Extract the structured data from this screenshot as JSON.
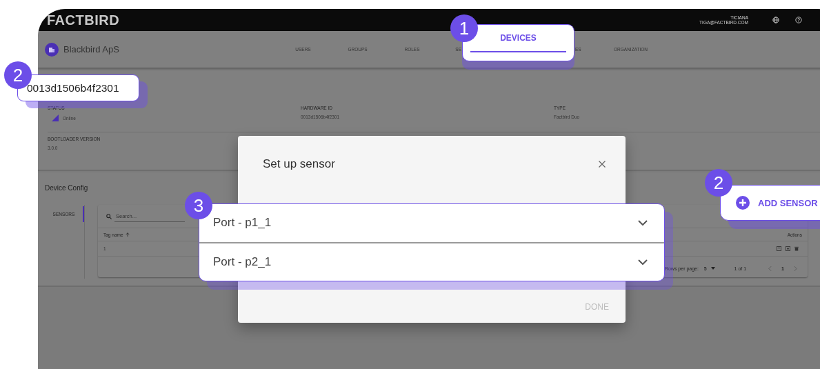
{
  "header": {
    "logo": "FACTBIRD",
    "user_name": "TICIANA",
    "user_email": "TIGA@FACTBIRD.COM"
  },
  "org_bar": {
    "name": "Blackbird ApS",
    "tabs": [
      {
        "label": "USERS",
        "selected": false
      },
      {
        "label": "GROUPS",
        "selected": false
      },
      {
        "label": "ROLES",
        "selected": false
      },
      {
        "label": "SE",
        "selected": false
      },
      {
        "label": "DEVICES",
        "selected": true,
        "step": "1"
      },
      {
        "label": "ES",
        "selected": false
      },
      {
        "label": "ORGANIZATION",
        "selected": false
      }
    ]
  },
  "hardware_id_callout": {
    "step": "2",
    "text": "0013d1506b4f2301"
  },
  "device_info": {
    "fields": [
      {
        "label": "STATUS",
        "value": "Online",
        "kind": "status"
      },
      {
        "label": "HARDWARE ID",
        "value": "0013d1506b4f2301",
        "kind": "text"
      },
      {
        "label": "TYPE",
        "value": "Factbird Duo",
        "kind": "text"
      },
      {
        "label": "BOOTLOADER VERSION",
        "value": "3.0.0",
        "kind": "text"
      }
    ]
  },
  "device_config": {
    "title": "Device Config",
    "side_tabs": [
      {
        "label": "SENSORS",
        "selected": true
      }
    ],
    "add_sensor": {
      "label": "ADD SENSOR",
      "step": "2"
    },
    "search": {
      "placeholder": "Search..."
    },
    "columns": [
      {
        "label": "Tag name",
        "sorted": true
      },
      {
        "label": "Actions",
        "sorted": false
      }
    ],
    "rows": [
      [
        "1"
      ]
    ],
    "pagination": {
      "rows_per_page_label": "Rows per page:",
      "rows_per_page": "5",
      "range": "1 of 1",
      "page": "1"
    }
  },
  "dialog": {
    "title": "Set up sensor",
    "done_label": "DONE",
    "done_disabled": true,
    "ports_step": "3",
    "ports": [
      {
        "label": "Port - p1_1",
        "expanded": false
      },
      {
        "label": "Port - p2_1",
        "expanded": false
      }
    ]
  }
}
